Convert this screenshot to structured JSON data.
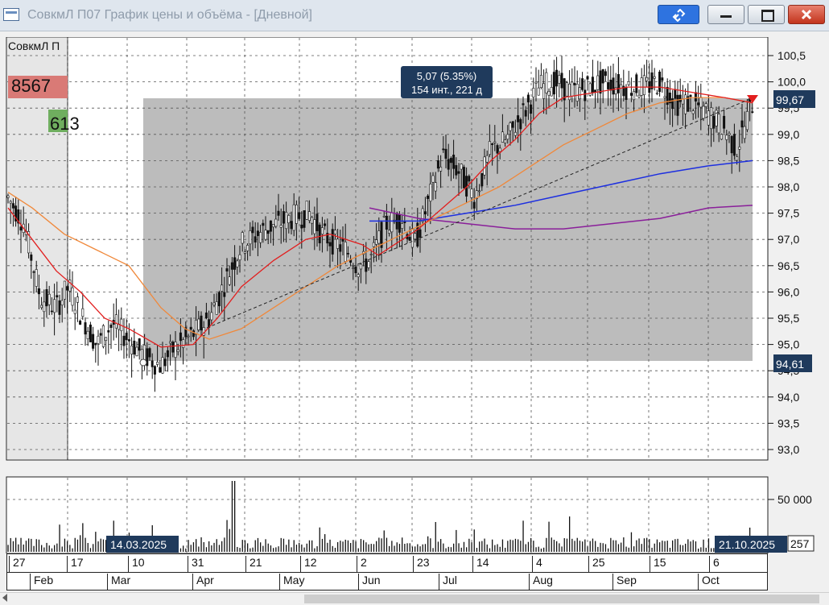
{
  "window": {
    "title": "СовкмЛ П07 График цены и объёма - [Дневной]",
    "buttons": {
      "link": "link-icon",
      "minimize": "minimize-icon",
      "maximize": "maximize-icon",
      "close": "close-icon"
    }
  },
  "price_panel": {
    "instrument_label": "СовкмЛ П",
    "badge_sell": "8567",
    "badge_buy": "613",
    "measure_line1": "5,07 (5.35%)",
    "measure_line2": "154 инт., 221 д",
    "last_price_label": "99,67",
    "low_price_label": "94,61",
    "y_ticks": [
      "100,5",
      "100,0",
      "99,5",
      "99,0",
      "98,5",
      "98,0",
      "97,5",
      "97,0",
      "96,5",
      "96,0",
      "95,5",
      "95,0",
      "94,5",
      "94,0",
      "93,5",
      "93,0"
    ]
  },
  "volume_panel": {
    "y_tick": "50 000",
    "last_volume": "257",
    "date_start": "14.03.2025",
    "date_end": "21.10.2025"
  },
  "time_axis": {
    "days": [
      "27",
      "17",
      "10",
      "31",
      "21",
      "12",
      "2",
      "23",
      "14",
      "4",
      "25",
      "15",
      "6"
    ],
    "months": [
      "Feb",
      "Mar",
      "Apr",
      "May",
      "Jun",
      "Jul",
      "Aug",
      "Sep",
      "Oct"
    ]
  },
  "colors": {
    "ma_fast": "#e21f1f",
    "ma_mid": "#f0883a",
    "ma_slow": "#1d2fe0",
    "ma_long": "#8a1f9a",
    "selection": "#b8b8b8",
    "badge_sell": "#d97a76",
    "badge_buy": "#6fae5f",
    "label_bg": "#1f3a5c"
  }
}
